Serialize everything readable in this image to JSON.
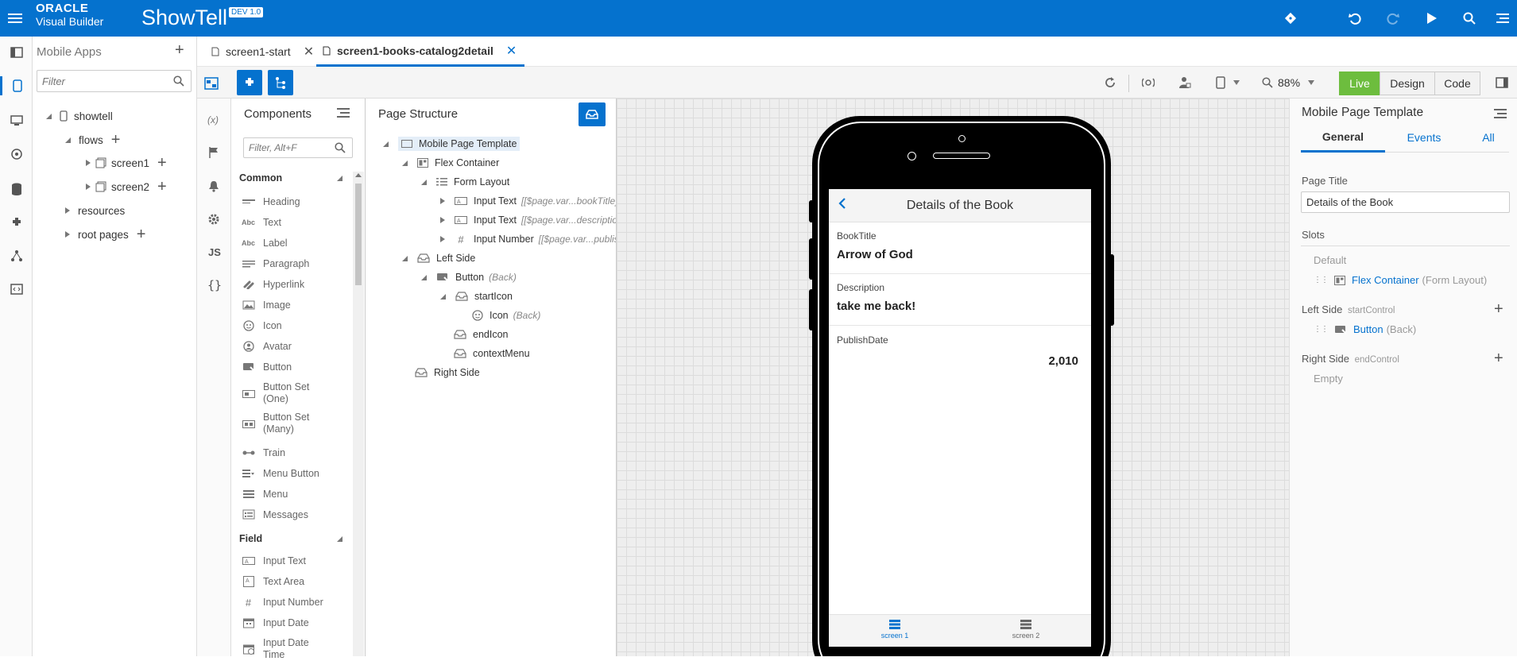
{
  "header": {
    "brand_line1": "ORACLE",
    "brand_line2": "Visual Builder",
    "app_name": "ShowTell",
    "env_badge": "DEV 1.0",
    "accent_color": "#0572ce",
    "icons": [
      "menu-icon",
      "git-icon",
      "undo-icon",
      "redo-icon",
      "run-icon",
      "search-icon",
      "more-icon"
    ]
  },
  "apps_panel": {
    "title": "Mobile Apps",
    "filter_placeholder": "Filter",
    "tree": {
      "root": "showtell",
      "flows": "flows",
      "screen1": "screen1",
      "screen2": "screen2",
      "resources": "resources",
      "root_pages": "root pages"
    }
  },
  "tabs": [
    {
      "label": "screen1-start",
      "active": false
    },
    {
      "label": "screen1-books-catalog2detail",
      "active": true
    }
  ],
  "toolbar": {
    "zoom": "88%",
    "modes": {
      "live": "Live",
      "design": "Design",
      "code": "Code"
    },
    "live_color": "#6dbd3e"
  },
  "components": {
    "title": "Components",
    "filter_placeholder": "Filter, Alt+F",
    "sections": {
      "common": "Common",
      "field": "Field"
    },
    "common_items": [
      "Heading",
      "Text",
      "Label",
      "Paragraph",
      "Hyperlink",
      "Image",
      "Icon",
      "Avatar",
      "Button",
      "Button Set (One)",
      "Button Set (Many)",
      "Train",
      "Menu Button",
      "Menu",
      "Messages"
    ],
    "field_items": [
      "Input Text",
      "Text Area",
      "Input Number",
      "Input Date",
      "Input Date Time"
    ]
  },
  "structure": {
    "title": "Page Structure",
    "nodes": {
      "template": "Mobile Page Template",
      "flex": "Flex Container",
      "form": "Form Layout",
      "input1": "Input Text",
      "input1_hint": "[[$page.var...bookTitle]]",
      "input2": "Input Text",
      "input2_hint": "[[$page.var...description]]",
      "input3": "Input Number",
      "input3_hint": "[[$page.var...publishDate]]",
      "left_side": "Left Side",
      "button": "Button",
      "button_hint": "(Back)",
      "start_icon": "startIcon",
      "icon": "Icon",
      "icon_hint": "(Back)",
      "end_icon": "endIcon",
      "context_menu": "contextMenu",
      "right_side": "Right Side"
    }
  },
  "preview": {
    "title": "Details of the Book",
    "fields": [
      {
        "label": "BookTitle",
        "value": "Arrow of God"
      },
      {
        "label": "Description",
        "value": "take me back!"
      },
      {
        "label": "PublishDate",
        "value": "2,010"
      }
    ],
    "nav": [
      {
        "label": "screen 1",
        "active": true
      },
      {
        "label": "screen 2",
        "active": false
      }
    ]
  },
  "properties": {
    "title": "Mobile Page Template",
    "tabs": {
      "general": "General",
      "events": "Events",
      "all": "All"
    },
    "page_title_label": "Page Title",
    "page_title_value": "Details of the Book",
    "slots_label": "Slots",
    "default_label": "Default",
    "default_item": "Flex Container",
    "default_item_hint": "(Form Layout)",
    "left_side_label": "Left Side",
    "left_side_hint": "startControl",
    "left_item": "Button",
    "left_item_hint": "(Back)",
    "right_side_label": "Right Side",
    "right_side_hint": "endControl",
    "right_empty": "Empty"
  }
}
